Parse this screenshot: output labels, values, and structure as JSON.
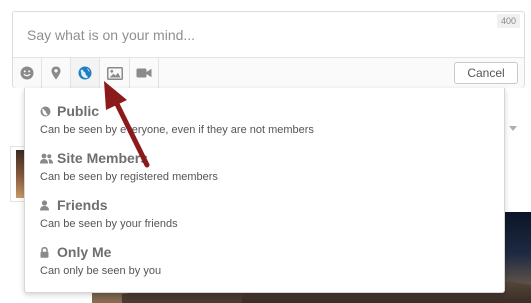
{
  "composer": {
    "placeholder": "Say what is on your mind...",
    "char_count": "400",
    "cancel_label": "Cancel",
    "toolbar_icons": [
      "emoji-icon",
      "location-icon",
      "privacy-globe-icon",
      "photo-icon",
      "video-icon"
    ]
  },
  "privacy_menu": {
    "options": [
      {
        "icon": "globe-icon",
        "title": "Public",
        "description": "Can be seen by everyone, even if they are not members"
      },
      {
        "icon": "users-icon",
        "title": "Site Members",
        "description": "Can be seen by registered members"
      },
      {
        "icon": "user-icon",
        "title": "Friends",
        "description": "Can be seen by your friends"
      },
      {
        "icon": "lock-icon",
        "title": "Only Me",
        "description": "Can only be seen by you"
      }
    ]
  },
  "colors": {
    "accent_blue": "#1f7fc4",
    "annotation_arrow": "#8b1a1a",
    "icon_gray": "#8a8a8a"
  }
}
